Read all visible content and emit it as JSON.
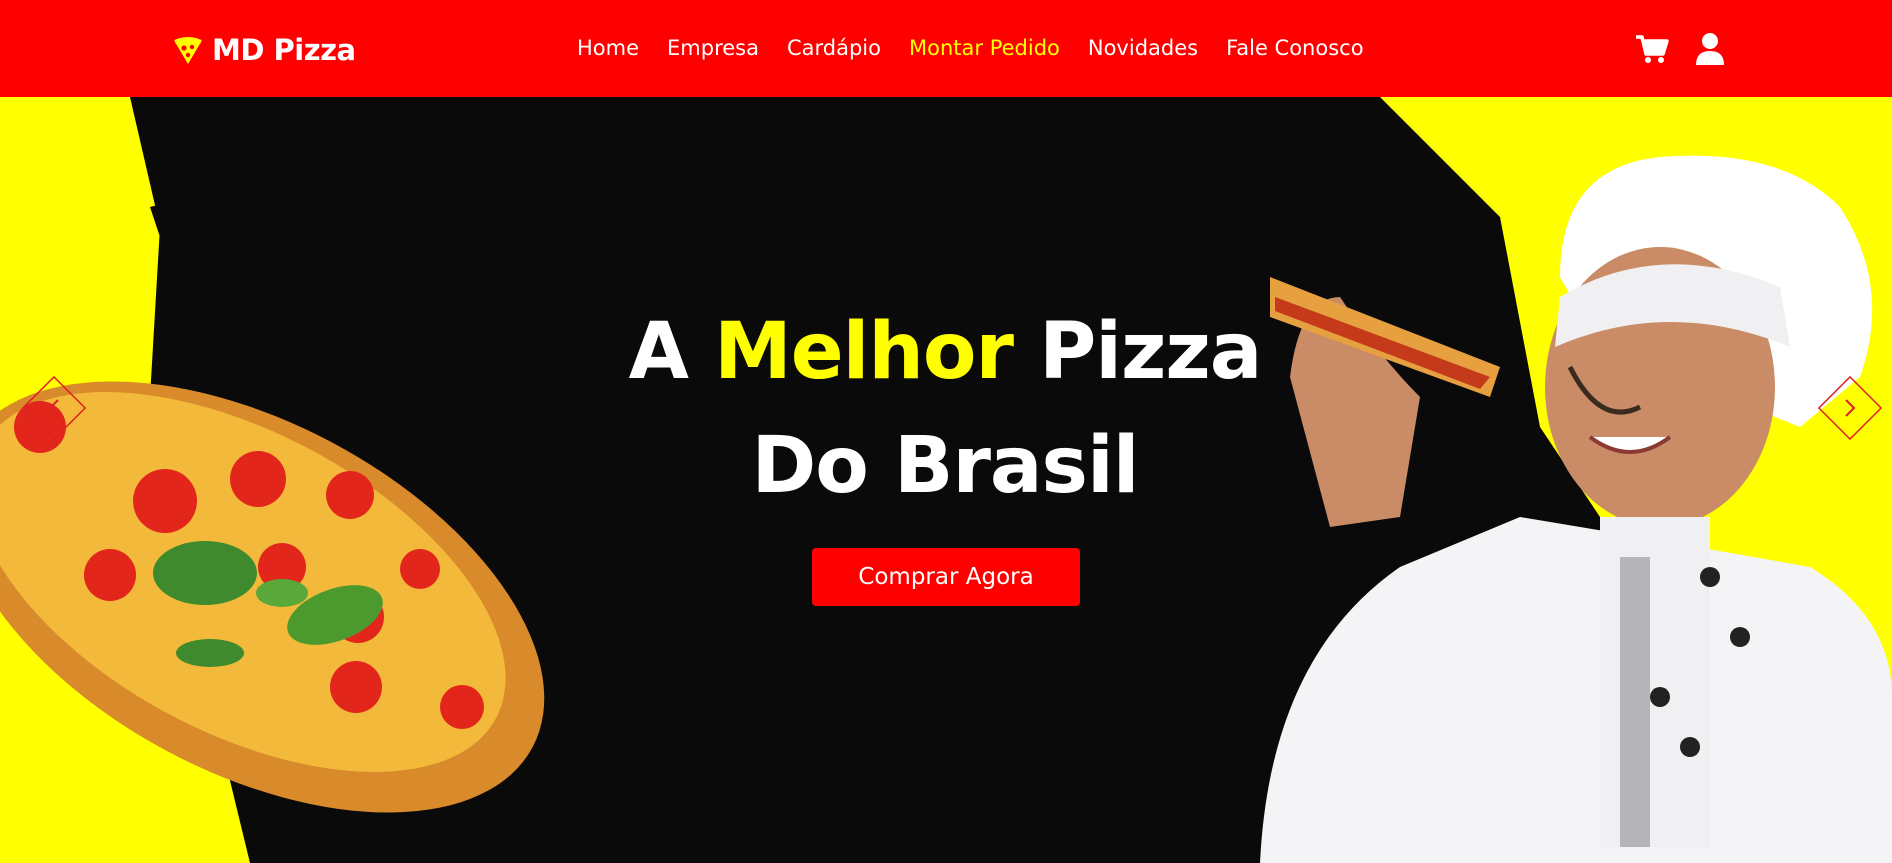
{
  "brand": {
    "name": "MD Pizza",
    "icon": "pizza-slice-icon",
    "color": "#ff0000",
    "accent": "#ffff00"
  },
  "nav": {
    "items": [
      {
        "label": "Home",
        "active": false
      },
      {
        "label": "Empresa",
        "active": false
      },
      {
        "label": "Cardápio",
        "active": false
      },
      {
        "label": "Montar Pedido",
        "active": true
      },
      {
        "label": "Novidades",
        "active": false
      },
      {
        "label": "Fale Conosco",
        "active": false
      }
    ]
  },
  "header_icons": [
    "cart-icon",
    "user-icon"
  ],
  "hero": {
    "title_part1": "A ",
    "title_highlight": "Melhor",
    "title_part2": " Pizza",
    "title_line2": "Do Brasil",
    "cta_label": "Comprar Agora"
  },
  "carousel": {
    "prev_icon": "chevron-left-icon",
    "next_icon": "chevron-right-icon"
  }
}
